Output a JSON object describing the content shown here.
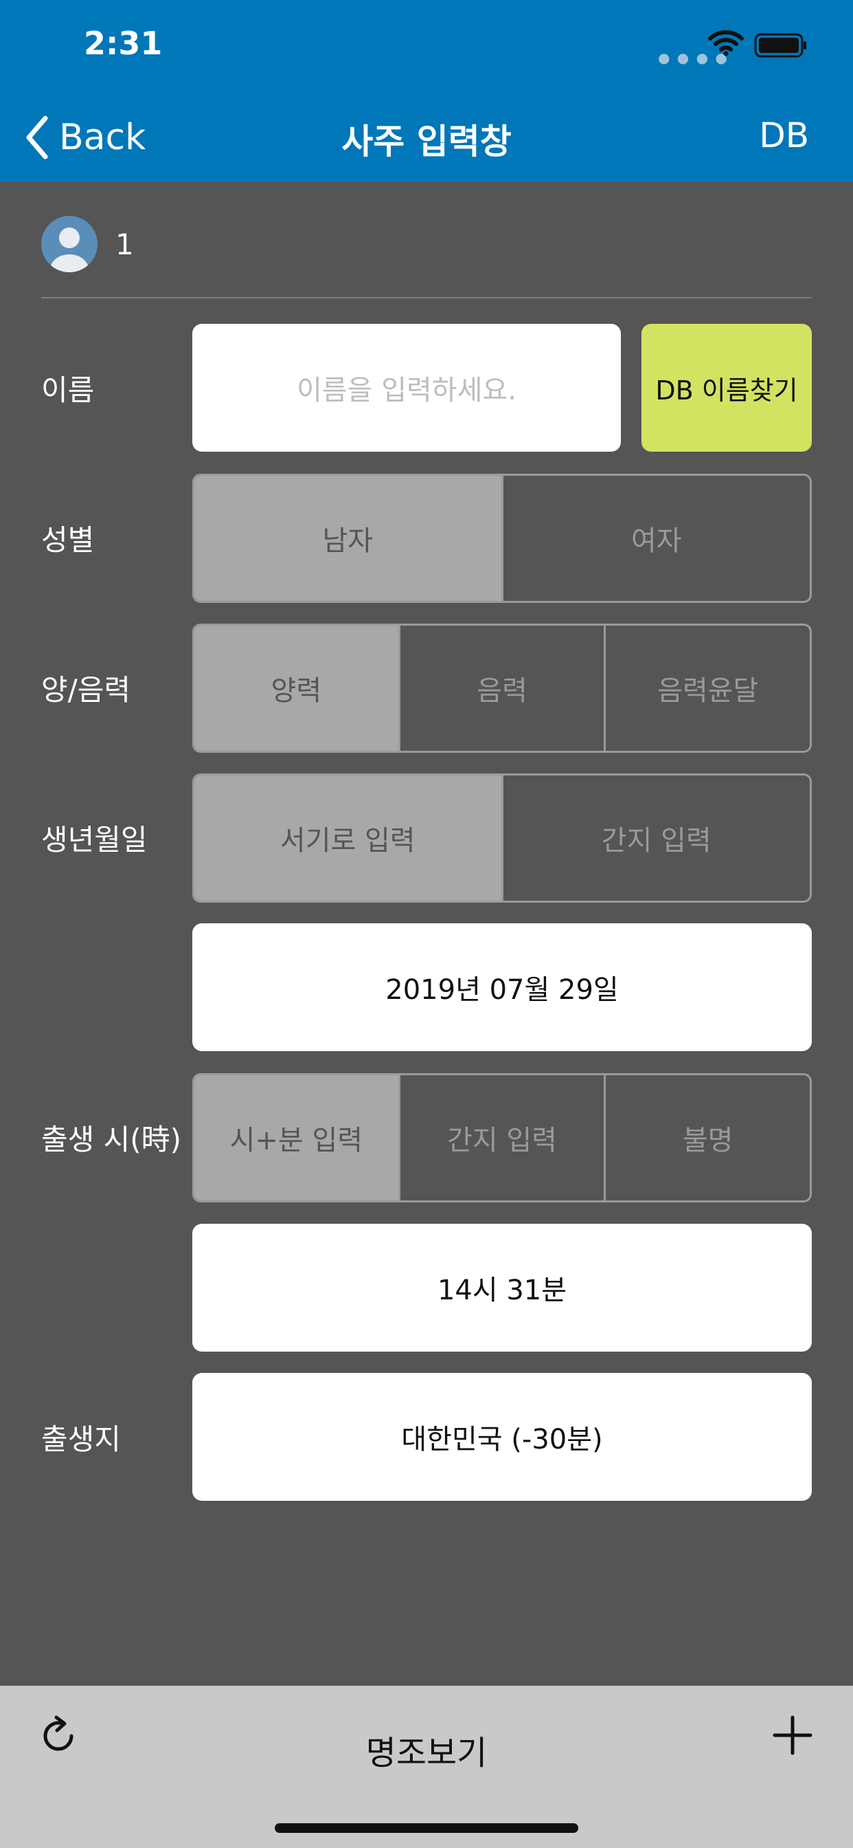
{
  "status_bar": {
    "time": "2:31"
  },
  "nav": {
    "back_label": "Back",
    "title": "사주 입력창",
    "db_label": "DB"
  },
  "profile": {
    "id": "1"
  },
  "form": {
    "name": {
      "label": "이름",
      "placeholder": "이름을 입력하세요.",
      "search_button": "DB 이름찾기"
    },
    "gender": {
      "label": "성별",
      "options": [
        "남자",
        "여자"
      ],
      "selected": "남자"
    },
    "calendar": {
      "label": "양/음력",
      "options": [
        "양력",
        "음력",
        "음력윤달"
      ],
      "selected": "양력"
    },
    "birthdate": {
      "label": "생년월일",
      "options": [
        "서기로 입력",
        "간지 입력"
      ],
      "selected": "서기로 입력",
      "value": "2019년 07월 29일"
    },
    "birthtime": {
      "label": "출생 시(時)",
      "options": [
        "시+분 입력",
        "간지 입력",
        "불명"
      ],
      "selected": "시+분 입력",
      "value": "14시 31분"
    },
    "birthplace": {
      "label": "출생지",
      "value": "대한민국 (-30분)"
    }
  },
  "bottom_bar": {
    "title": "명조보기"
  },
  "colors": {
    "header": "#0077b8",
    "background": "#555555",
    "accent_button": "#d4e262",
    "bottom_bar": "#c9c9c9"
  },
  "icons": [
    "chevron-left-icon",
    "wifi-icon",
    "battery-icon",
    "avatar-icon",
    "refresh-icon",
    "plus-icon"
  ]
}
